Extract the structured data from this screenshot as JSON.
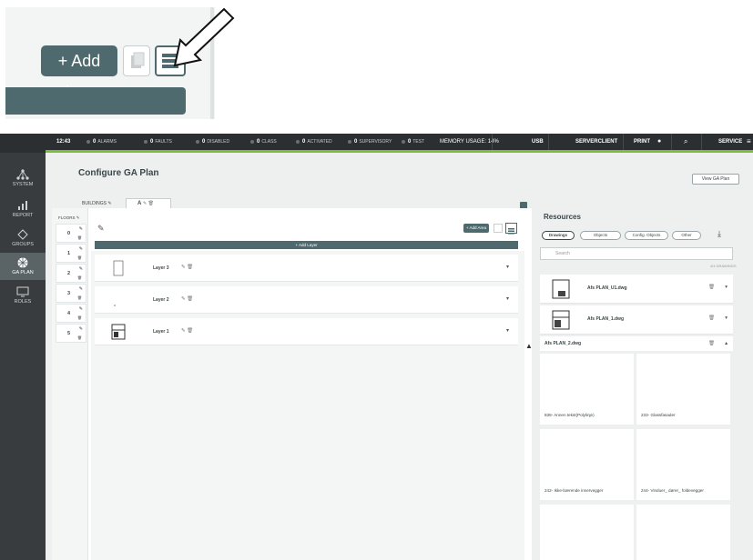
{
  "zoom": {
    "add_area_label": "+ Add Area"
  },
  "topbar": {
    "time": "12:43",
    "items": [
      {
        "count": "0",
        "label": "ALARMS"
      },
      {
        "count": "0",
        "label": "FAULTS"
      },
      {
        "count": "0",
        "label": "DISABLED"
      },
      {
        "count": "0",
        "label": "CLASS"
      },
      {
        "count": "0",
        "label": "ACTIVATED"
      },
      {
        "count": "0",
        "label": "SUPERVISORY"
      },
      {
        "count": "0",
        "label": "TEST"
      }
    ],
    "memory": "Memory usage: 14%",
    "usb": "USB",
    "server": "ServerClient",
    "print": "PRINT",
    "service": "SERVICE"
  },
  "sidebar": {
    "items": [
      {
        "label": "SYSTEM",
        "icon": "network-icon"
      },
      {
        "label": "REPORT",
        "icon": "bar-chart-icon"
      },
      {
        "label": "GROUPS",
        "icon": "groups-icon"
      },
      {
        "label": "GA PLAN",
        "icon": "grid-icon"
      },
      {
        "label": "ROLES",
        "icon": "monitor-icon"
      }
    ]
  },
  "page": {
    "title": "Configure GA Plan",
    "view_button": "View GA Plan"
  },
  "buildings": {
    "label": "BUILDINGS",
    "tab": "A"
  },
  "floors": {
    "label": "FLOORS",
    "add": "+",
    "items": [
      "0",
      "1",
      "2",
      "3",
      "4",
      "5"
    ]
  },
  "toolbar": {
    "add_area": "+ Add Area",
    "add_layer": "+ Add Layer"
  },
  "layers": [
    {
      "name": "Layer 3"
    },
    {
      "name": "Layer 2"
    },
    {
      "name": "Layer 1"
    }
  ],
  "resources": {
    "title": "Resources",
    "tabs": [
      "Drawings",
      "Objects",
      "Config. Objects",
      "Other"
    ],
    "search_placeholder": "Search",
    "count": "4/4 DRAWINGS",
    "drawings": [
      "Afs PLAN_U1.dwg",
      "Afs PLAN_1.dwg",
      "Afs PLAN_2.dwg"
    ],
    "objects": [
      "838- Annen tekst(Polylinje)",
      "233- Glassfasader",
      "242- Ikke-bærende innervegger",
      "244- Vinduer_ dører_ foldevegger"
    ]
  }
}
